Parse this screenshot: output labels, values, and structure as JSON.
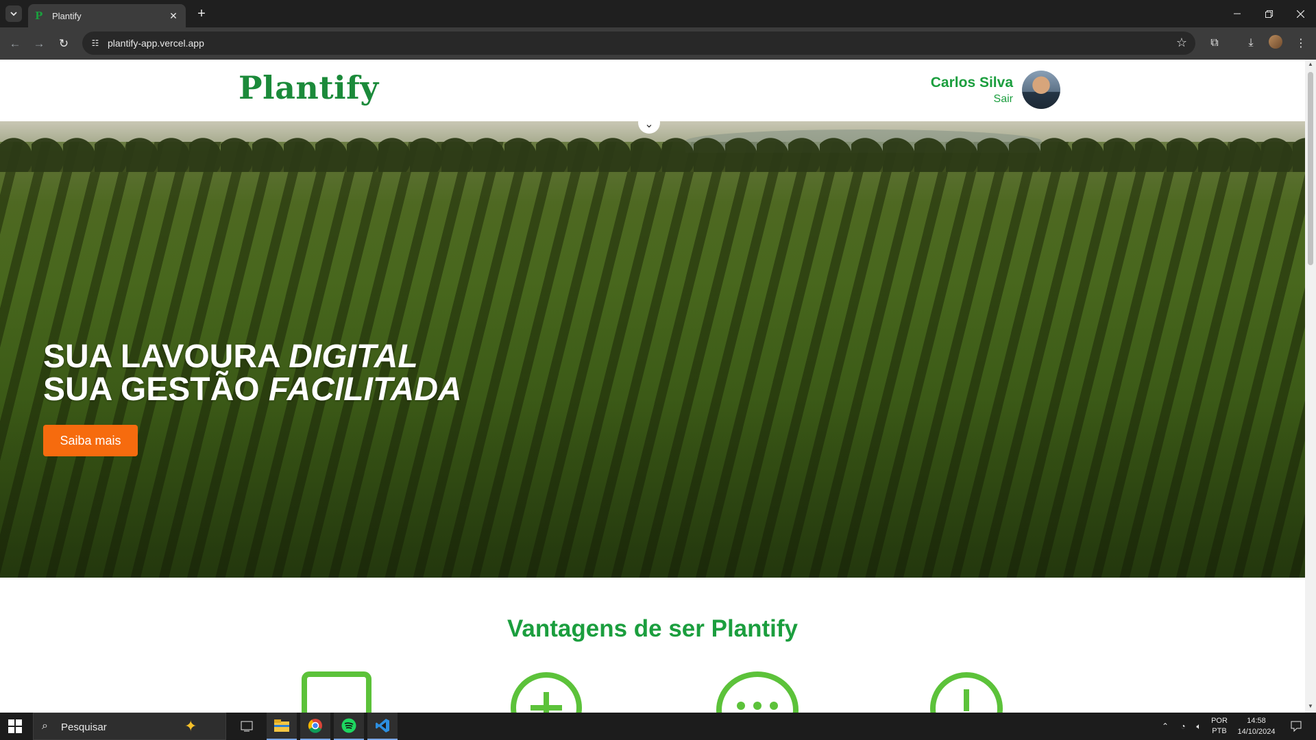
{
  "browser": {
    "tab_title": "Plantify",
    "tab_favicon": "P",
    "new_tab": "+",
    "url": "plantify-app.vercel.app",
    "icons": [
      "tab-list-icon",
      "close-icon",
      "back-icon",
      "forward-icon",
      "reload-icon",
      "site-info-icon",
      "star-icon",
      "extensions-icon",
      "download-icon",
      "profile-icon",
      "menu-icon",
      "minimize-icon",
      "restore-icon",
      "window-close-icon"
    ]
  },
  "header": {
    "logo": "Plantify",
    "user_name": "Carlos Silva",
    "logout": "Sair"
  },
  "hero": {
    "line1_plain": "SUA LAVOURA ",
    "line1_emph": "DIGITAL",
    "line2_plain": "SUA GESTÃO ",
    "line2_emph": "FACILITADA",
    "cta_label": "Saiba mais"
  },
  "advantages": {
    "title": "Vantagens de ser Plantify",
    "icons": [
      "tablet-icon",
      "plus-circle-icon",
      "chat-dots-icon",
      "clock-icon"
    ]
  },
  "taskbar": {
    "search_placeholder": "Pesquisar",
    "lang_top": "POR",
    "lang_bottom": "PTB",
    "time": "14:58",
    "date": "14/10/2024"
  },
  "colors": {
    "brand_green": "#1b9e3e",
    "cta_orange": "#f66b0e"
  }
}
